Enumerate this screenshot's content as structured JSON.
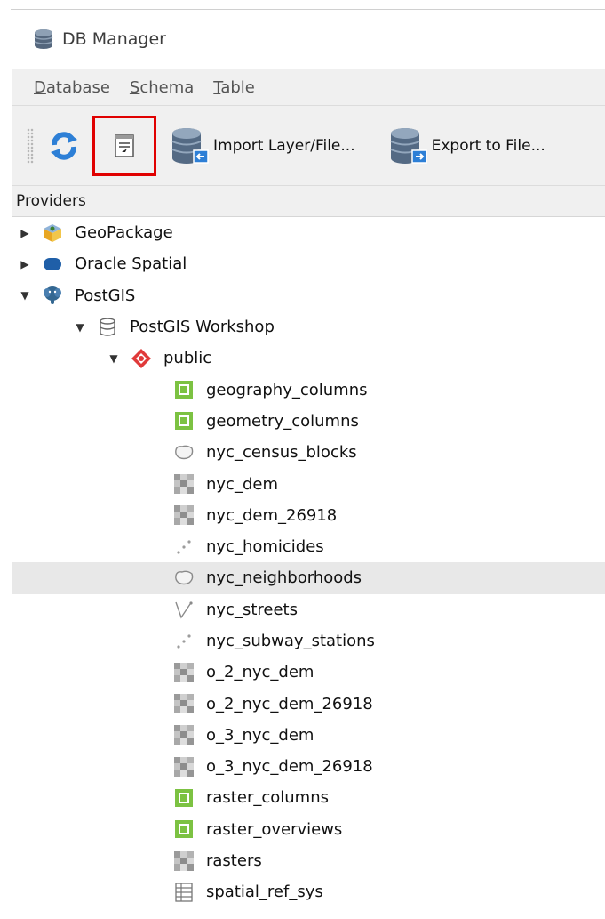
{
  "window": {
    "title": "DB Manager"
  },
  "menubar": {
    "items": [
      {
        "key": "D",
        "rest": "atabase"
      },
      {
        "key": "S",
        "rest": "chema"
      },
      {
        "key": "T",
        "rest": "able"
      }
    ]
  },
  "toolbar": {
    "import_label": "Import Layer/File...",
    "export_label": "Export to File..."
  },
  "providers": {
    "header": "Providers"
  },
  "tree": {
    "geopackage": "GeoPackage",
    "oracle": "Oracle Spatial",
    "postgis": "PostGIS",
    "connection": "PostGIS Workshop",
    "schema": "public",
    "tables": [
      {
        "name": "geography_columns",
        "icon": "table-green-icon"
      },
      {
        "name": "geometry_columns",
        "icon": "table-green-icon"
      },
      {
        "name": "nyc_census_blocks",
        "icon": "polygon-layer-icon"
      },
      {
        "name": "nyc_dem",
        "icon": "raster-layer-icon"
      },
      {
        "name": "nyc_dem_26918",
        "icon": "raster-layer-icon"
      },
      {
        "name": "nyc_homicides",
        "icon": "point-layer-icon"
      },
      {
        "name": "nyc_neighborhoods",
        "icon": "polygon-layer-icon",
        "selected": true
      },
      {
        "name": "nyc_streets",
        "icon": "line-layer-icon"
      },
      {
        "name": "nyc_subway_stations",
        "icon": "point-layer-icon"
      },
      {
        "name": "o_2_nyc_dem",
        "icon": "raster-layer-icon"
      },
      {
        "name": "o_2_nyc_dem_26918",
        "icon": "raster-layer-icon"
      },
      {
        "name": "o_3_nyc_dem",
        "icon": "raster-layer-icon"
      },
      {
        "name": "o_3_nyc_dem_26918",
        "icon": "raster-layer-icon"
      },
      {
        "name": "raster_columns",
        "icon": "table-green-icon"
      },
      {
        "name": "raster_overviews",
        "icon": "table-green-icon"
      },
      {
        "name": "rasters",
        "icon": "raster-layer-icon"
      },
      {
        "name": "spatial_ref_sys",
        "icon": "table-plain-icon"
      }
    ]
  },
  "colors": {
    "highlight_box": "#e00000",
    "selected_row": "#e8e8e8",
    "toolbar_bg": "#f0f0f0"
  }
}
